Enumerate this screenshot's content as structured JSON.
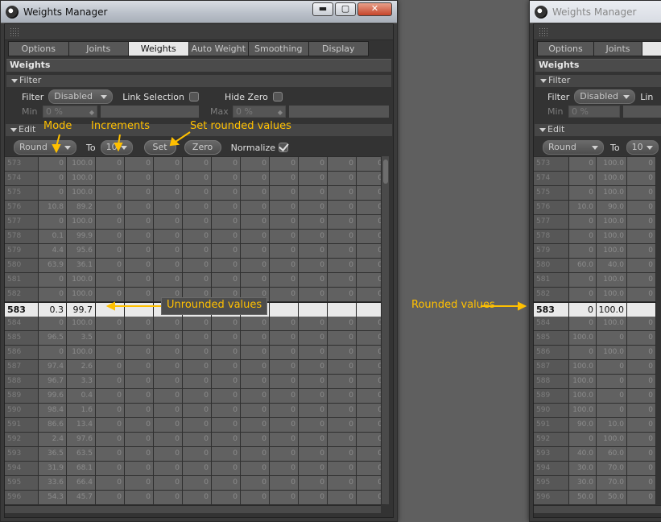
{
  "window": {
    "title": "Weights Manager",
    "minimize_glyph": "▬",
    "maximize_glyph": "▢",
    "close_glyph": "✕"
  },
  "tabs": [
    {
      "label": "Options",
      "active": false
    },
    {
      "label": "Joints",
      "active": false
    },
    {
      "label": "Weights",
      "active": true
    },
    {
      "label": "Auto Weight",
      "active": false
    },
    {
      "label": "Smoothing",
      "active": false
    },
    {
      "label": "Display",
      "active": false
    }
  ],
  "weights_section": {
    "title": "Weights"
  },
  "filter": {
    "title": "Filter",
    "filter_label": "Filter",
    "filter_value": "Disabled",
    "link_selection_label": "Link Selection",
    "link_selection_checked": false,
    "hide_zero_label": "Hide Zero",
    "hide_zero_checked": false,
    "min_label": "Min",
    "min_value": "0 %",
    "max_label": "Max",
    "max_value": "0 %"
  },
  "edit": {
    "title": "Edit",
    "mode_value": "Round",
    "to_label": "To",
    "increment_value": "10",
    "set_label": "Set",
    "zero_label": "Zero",
    "normalize_label": "Normalize",
    "normalize_checked": true
  },
  "annotations": {
    "mode": "Mode",
    "increments": "Increments",
    "set_rounded": "Set rounded values",
    "unrounded": "Unrounded values",
    "rounded": "Rounded values"
  },
  "left_table": {
    "rows": [
      [
        "573",
        "0",
        "100.0"
      ],
      [
        "574",
        "0",
        "100.0"
      ],
      [
        "575",
        "0",
        "100.0"
      ],
      [
        "576",
        "10.8",
        "89.2"
      ],
      [
        "577",
        "0",
        "100.0"
      ],
      [
        "578",
        "0.1",
        "99.9"
      ],
      [
        "579",
        "4.4",
        "95.6"
      ],
      [
        "580",
        "63.9",
        "36.1"
      ],
      [
        "581",
        "0",
        "100.0"
      ],
      [
        "582",
        "0",
        "100.0"
      ],
      [
        "583",
        "0.3",
        "99.7"
      ],
      [
        "584",
        "0",
        "100.0"
      ],
      [
        "585",
        "96.5",
        "3.5"
      ],
      [
        "586",
        "0",
        "100.0"
      ],
      [
        "587",
        "97.4",
        "2.6"
      ],
      [
        "588",
        "96.7",
        "3.3"
      ],
      [
        "589",
        "99.6",
        "0.4"
      ],
      [
        "590",
        "98.4",
        "1.6"
      ],
      [
        "591",
        "86.6",
        "13.4"
      ],
      [
        "592",
        "2.4",
        "97.6"
      ],
      [
        "593",
        "36.5",
        "63.5"
      ],
      [
        "594",
        "31.9",
        "68.1"
      ],
      [
        "595",
        "33.6",
        "66.4"
      ],
      [
        "596",
        "54.3",
        "45.7"
      ]
    ],
    "zero": "0",
    "highlight_index": 10
  },
  "right_window": {
    "title": "Weights Manager",
    "tabs": [
      "Options",
      "Joints"
    ],
    "section_title": "Weights",
    "filter_title": "Filter",
    "filter_label": "Filter",
    "filter_value": "Disabled",
    "link_label": "Lin",
    "min_label": "Min",
    "min_value": "0 %",
    "edit_title": "Edit",
    "mode_value": "Round",
    "to_label": "To",
    "increment_value": "10",
    "rows": [
      [
        "573",
        "0",
        "100.0"
      ],
      [
        "574",
        "0",
        "100.0"
      ],
      [
        "575",
        "0",
        "100.0"
      ],
      [
        "576",
        "10.0",
        "90.0"
      ],
      [
        "577",
        "0",
        "100.0"
      ],
      [
        "578",
        "0",
        "100.0"
      ],
      [
        "579",
        "0",
        "100.0"
      ],
      [
        "580",
        "60.0",
        "40.0"
      ],
      [
        "581",
        "0",
        "100.0"
      ],
      [
        "582",
        "0",
        "100.0"
      ],
      [
        "583",
        "0",
        "100.0"
      ],
      [
        "584",
        "0",
        "100.0"
      ],
      [
        "585",
        "100.0",
        "0"
      ],
      [
        "586",
        "0",
        "100.0"
      ],
      [
        "587",
        "100.0",
        "0"
      ],
      [
        "588",
        "100.0",
        "0"
      ],
      [
        "589",
        "100.0",
        "0"
      ],
      [
        "590",
        "100.0",
        "0"
      ],
      [
        "591",
        "90.0",
        "10.0"
      ],
      [
        "592",
        "0",
        "100.0"
      ],
      [
        "593",
        "40.0",
        "60.0"
      ],
      [
        "594",
        "30.0",
        "70.0"
      ],
      [
        "595",
        "30.0",
        "70.0"
      ],
      [
        "596",
        "50.0",
        "50.0"
      ]
    ],
    "zero": "0",
    "highlight_index": 10
  }
}
